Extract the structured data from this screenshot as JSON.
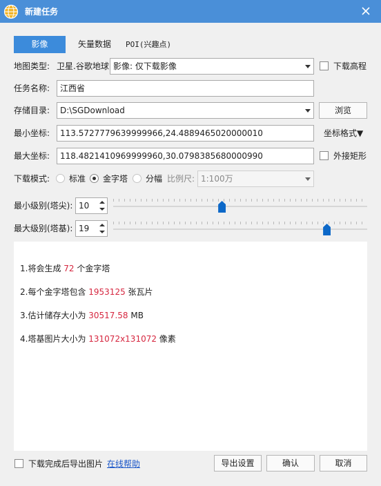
{
  "window": {
    "title": "新建任务"
  },
  "tabs": [
    "影像",
    "矢量数据",
    "POI(兴趣点)"
  ],
  "map_type": {
    "label": "地图类型:",
    "source": "卫星.谷歌地球",
    "selected": "影像: 仅下载影像"
  },
  "download_elevation": {
    "label": "下载高程",
    "checked": false
  },
  "task_name": {
    "label": "任务名称:",
    "value": "江西省"
  },
  "storage_dir": {
    "label": "存储目录:",
    "value": "D:\\SGDownload",
    "browse_label": "浏览"
  },
  "min_coord": {
    "label": "最小坐标:",
    "value": "113.5727779639999966,24.4889465020000010",
    "format_label": "坐标格式▼"
  },
  "max_coord": {
    "label": "最大坐标:",
    "value": "118.4821410969999960,30.0798385680000990"
  },
  "outer_rect": {
    "label": "外接矩形",
    "checked": false
  },
  "download_mode": {
    "label": "下载模式:",
    "options": [
      "标准",
      "金字塔",
      "分幅"
    ],
    "selected": "金字塔",
    "scale_label": "比例尺:",
    "scale_value": "1:100万"
  },
  "min_level": {
    "label": "最小级别(塔尖):",
    "value": "10",
    "slider_fraction": 0.427
  },
  "max_level": {
    "label": "最大级别(塔基):",
    "value": "19",
    "slider_fraction": 0.84
  },
  "info": {
    "line1": {
      "prefix": "1.将会生成 ",
      "value": "72",
      "suffix": " 个金字塔"
    },
    "line2": {
      "prefix": "2.每个金字塔包含 ",
      "value": "1953125",
      "suffix": " 张瓦片"
    },
    "line3": {
      "prefix": "3.估计储存大小为 ",
      "value": "30517.58",
      "suffix": " MB"
    },
    "line4": {
      "prefix": "4.塔基图片大小为 ",
      "value": "131072x131072",
      "suffix": " 像素"
    }
  },
  "footer": {
    "export_after_label": "下载完成后导出图片",
    "export_after_checked": false,
    "help_link": "在线帮助",
    "export_settings_label": "导出设置",
    "confirm_label": "确认",
    "cancel_label": "取消"
  },
  "colors": {
    "titlebar": "#4a8fd8",
    "active_tab": "#3c8bdb",
    "highlight": "#d6263f",
    "slider_thumb": "#0c68c8",
    "link": "#1a56c8"
  }
}
